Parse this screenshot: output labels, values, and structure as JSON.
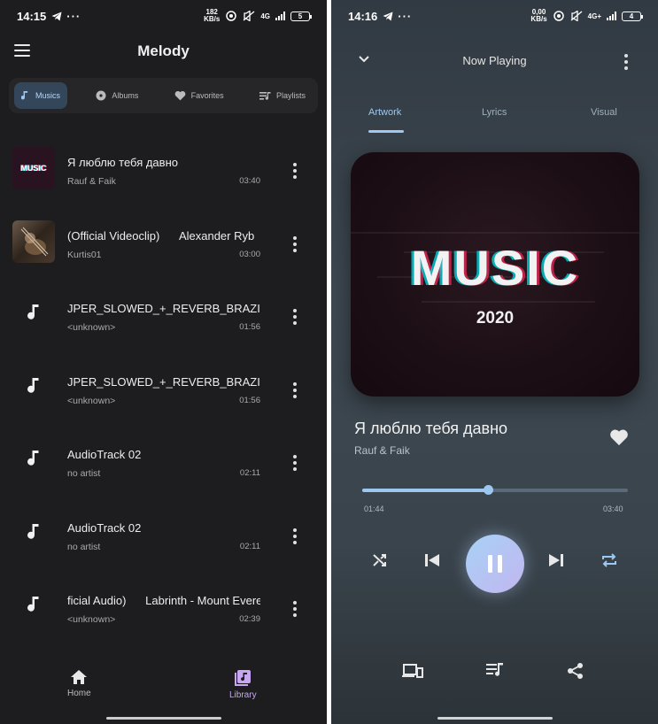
{
  "left": {
    "status": {
      "time": "14:15",
      "battery": "5",
      "speed_top": "182",
      "speed_unit": "KB/s",
      "network": "4G"
    },
    "app_title": "Melody",
    "tabs": [
      {
        "label": "Musics",
        "icon": "music-note-icon",
        "active": true
      },
      {
        "label": "Albums",
        "icon": "disc-icon",
        "active": false
      },
      {
        "label": "Favorites",
        "icon": "heart-icon",
        "active": false
      },
      {
        "label": "Playlists",
        "icon": "playlist-icon",
        "active": false
      }
    ],
    "songs": [
      {
        "title": "Я люблю тебя давно",
        "artist": "Rauf & Faik",
        "duration": "03:40",
        "thumb": "music-2020-artwork"
      },
      {
        "title": "(Official Videoclip)      Alexander Ryb",
        "artist": "Kurtis01",
        "duration": "03:00",
        "thumb": "guitar-photo"
      },
      {
        "title": "JPER_SLOWED_+_REVERB_BRAZILIAI",
        "artist": "<unknown>",
        "duration": "01:56",
        "thumb": "music-note-icon"
      },
      {
        "title": "JPER_SLOWED_+_REVERB_BRAZILIAI",
        "artist": "<unknown>",
        "duration": "01:56",
        "thumb": "music-note-icon"
      },
      {
        "title": "AudioTrack 02",
        "artist": "no artist",
        "duration": "02:11",
        "thumb": "music-note-icon"
      },
      {
        "title": "AudioTrack 02",
        "artist": "no artist",
        "duration": "02:11",
        "thumb": "music-note-icon"
      },
      {
        "title": "ficial Audio)      Labrinth - Mount Evere",
        "artist": "<unknown>",
        "duration": "02:39",
        "thumb": "music-note-icon"
      }
    ],
    "nav": {
      "home": "Home",
      "library": "Library"
    }
  },
  "right": {
    "status": {
      "time": "14:16",
      "battery": "4",
      "speed_top": "0,00",
      "speed_unit": "KB/s",
      "network": "4G+"
    },
    "header_title": "Now Playing",
    "tabs": {
      "artwork": "Artwork",
      "lyrics": "Lyrics",
      "visual": "Visual"
    },
    "artwork": {
      "title": "MUSIC",
      "year": "2020"
    },
    "song_title": "Я люблю тебя давно",
    "artist": "Rauf & Faik",
    "progress": {
      "current": "01:44",
      "total": "03:40",
      "fraction": 0.4727
    },
    "colors": {
      "accent": "#9cc7f0",
      "play_gradient_start": "#a7d2f5",
      "play_gradient_end": "#c3b6f0"
    }
  }
}
